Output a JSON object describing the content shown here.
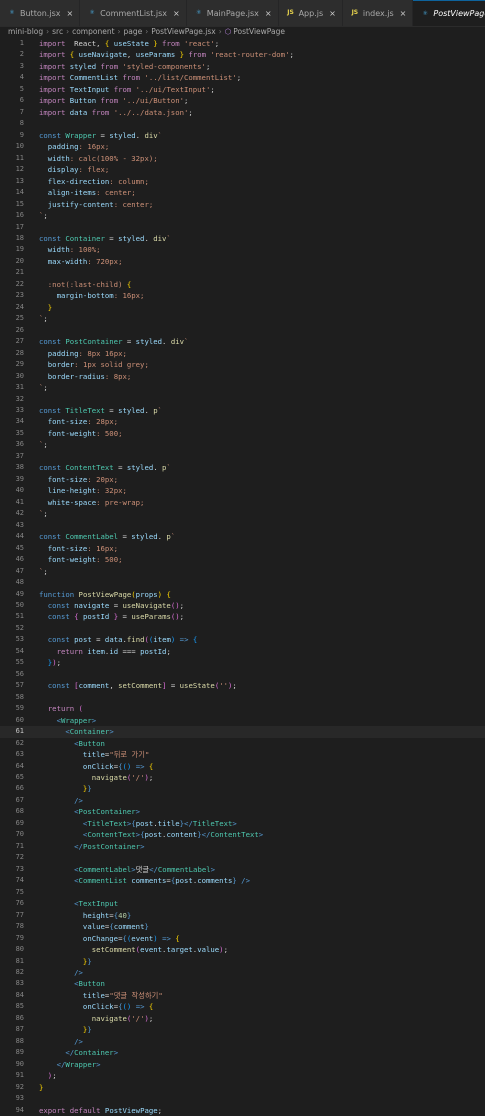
{
  "tabs": [
    {
      "label": "Button.jsx",
      "icon": "react-icon",
      "active": false
    },
    {
      "label": "CommentList.jsx",
      "icon": "react-icon",
      "active": false
    },
    {
      "label": "MainPage.jsx",
      "icon": "react-icon",
      "active": false
    },
    {
      "label": "App.js",
      "icon": "js-icon",
      "active": false
    },
    {
      "label": "index.js",
      "icon": "js-icon",
      "active": false
    },
    {
      "label": "PostViewPage.jsx",
      "icon": "react-icon",
      "active": true
    }
  ],
  "breadcrumb": [
    "mini-blog",
    "src",
    "component",
    "page",
    "PostViewPage.jsx",
    "PostViewPage"
  ],
  "active_line": 61,
  "lines": [
    [
      [
        "kw",
        "import"
      ],
      [
        "",
        "  React, "
      ],
      [
        "br1",
        "{"
      ],
      [
        "var",
        " useState "
      ],
      [
        "br1",
        "}"
      ],
      [
        "kw",
        " from "
      ],
      [
        "str",
        "'react'"
      ],
      [
        "",
        ";"
      ]
    ],
    [
      [
        "kw",
        "import"
      ],
      [
        "",
        " "
      ],
      [
        "br1",
        "{"
      ],
      [
        "var",
        " useNavigate"
      ],
      [
        "",
        ", "
      ],
      [
        "var",
        "useParams "
      ],
      [
        "br1",
        "}"
      ],
      [
        "kw",
        " from "
      ],
      [
        "str",
        "'react-router-dom'"
      ],
      [
        "",
        ";"
      ]
    ],
    [
      [
        "kw",
        "import"
      ],
      [
        "var",
        " styled"
      ],
      [
        "kw",
        " from "
      ],
      [
        "str",
        "'styled-components'"
      ],
      [
        "",
        ";"
      ]
    ],
    [
      [
        "kw",
        "import"
      ],
      [
        "var",
        " CommentList"
      ],
      [
        "kw",
        " from "
      ],
      [
        "str",
        "'../list/CommentList'"
      ],
      [
        "",
        ";"
      ]
    ],
    [
      [
        "kw",
        "import"
      ],
      [
        "var",
        " TextInput"
      ],
      [
        "kw",
        " from "
      ],
      [
        "str",
        "'../ui/TextInput'"
      ],
      [
        "",
        ";"
      ]
    ],
    [
      [
        "kw",
        "import"
      ],
      [
        "var",
        " Button"
      ],
      [
        "kw",
        " from "
      ],
      [
        "str",
        "'../ui/Button'"
      ],
      [
        "",
        ";"
      ]
    ],
    [
      [
        "kw",
        "import"
      ],
      [
        "var",
        " data"
      ],
      [
        "kw",
        " from "
      ],
      [
        "str",
        "'../../data.json'"
      ],
      [
        "",
        ";"
      ]
    ],
    [],
    [
      [
        "st",
        "const "
      ],
      [
        "comp",
        "Wrapper"
      ],
      [
        "",
        " = "
      ],
      [
        "var",
        "styled"
      ],
      [
        "",
        ". "
      ],
      [
        "fn",
        "div"
      ],
      [
        "str",
        "`"
      ]
    ],
    [
      [
        "cssp",
        "  padding"
      ],
      [
        "str",
        ": 16px;"
      ]
    ],
    [
      [
        "cssp",
        "  width"
      ],
      [
        "str",
        ": calc(100% - 32px);"
      ]
    ],
    [
      [
        "cssp",
        "  display"
      ],
      [
        "str",
        ": flex;"
      ]
    ],
    [
      [
        "cssp",
        "  flex-direction"
      ],
      [
        "str",
        ": column;"
      ]
    ],
    [
      [
        "cssp",
        "  align-items"
      ],
      [
        "str",
        ": center;"
      ]
    ],
    [
      [
        "cssp",
        "  justify-content"
      ],
      [
        "str",
        ": center;"
      ]
    ],
    [
      [
        "str",
        "`"
      ],
      [
        "",
        ";"
      ]
    ],
    [],
    [
      [
        "st",
        "const "
      ],
      [
        "comp",
        "Container"
      ],
      [
        "",
        " = "
      ],
      [
        "var",
        "styled"
      ],
      [
        "",
        ". "
      ],
      [
        "fn",
        "div"
      ],
      [
        "str",
        "`"
      ]
    ],
    [
      [
        "cssp",
        "  width"
      ],
      [
        "str",
        ": 100%;"
      ]
    ],
    [
      [
        "cssp",
        "  max-width"
      ],
      [
        "str",
        ": 720px;"
      ]
    ],
    [],
    [
      [
        "str",
        "  :not(:last-child) "
      ],
      [
        "br1",
        "{"
      ]
    ],
    [
      [
        "cssp",
        "    margin-bottom"
      ],
      [
        "str",
        ": 16px;"
      ]
    ],
    [
      [
        "br1",
        "  }"
      ]
    ],
    [
      [
        "str",
        "`"
      ],
      [
        "",
        ";"
      ]
    ],
    [],
    [
      [
        "st",
        "const "
      ],
      [
        "comp",
        "PostContainer"
      ],
      [
        "",
        " = "
      ],
      [
        "var",
        "styled"
      ],
      [
        "",
        ". "
      ],
      [
        "fn",
        "div"
      ],
      [
        "str",
        "`"
      ]
    ],
    [
      [
        "cssp",
        "  padding"
      ],
      [
        "str",
        ": 8px 16px;"
      ]
    ],
    [
      [
        "cssp",
        "  border"
      ],
      [
        "str",
        ": 1px solid grey;"
      ]
    ],
    [
      [
        "cssp",
        "  border-radius"
      ],
      [
        "str",
        ": 8px;"
      ]
    ],
    [
      [
        "str",
        "`"
      ],
      [
        "",
        ";"
      ]
    ],
    [],
    [
      [
        "st",
        "const "
      ],
      [
        "comp",
        "TitleText"
      ],
      [
        "",
        " = "
      ],
      [
        "var",
        "styled"
      ],
      [
        "",
        ". "
      ],
      [
        "fn",
        "p"
      ],
      [
        "str",
        "`"
      ]
    ],
    [
      [
        "cssp",
        "  font-size"
      ],
      [
        "str",
        ": 28px;"
      ]
    ],
    [
      [
        "cssp",
        "  font-weight"
      ],
      [
        "str",
        ": 500;"
      ]
    ],
    [
      [
        "str",
        "`"
      ],
      [
        "",
        ";"
      ]
    ],
    [],
    [
      [
        "st",
        "const "
      ],
      [
        "comp",
        "ContentText"
      ],
      [
        "",
        " = "
      ],
      [
        "var",
        "styled"
      ],
      [
        "",
        ". "
      ],
      [
        "fn",
        "p"
      ],
      [
        "str",
        "`"
      ]
    ],
    [
      [
        "cssp",
        "  font-size"
      ],
      [
        "str",
        ": 20px;"
      ]
    ],
    [
      [
        "cssp",
        "  line-height"
      ],
      [
        "str",
        ": 32px;"
      ]
    ],
    [
      [
        "cssp",
        "  white-space"
      ],
      [
        "str",
        ": pre-wrap;"
      ]
    ],
    [
      [
        "str",
        "`"
      ],
      [
        "",
        ";"
      ]
    ],
    [],
    [
      [
        "st",
        "const "
      ],
      [
        "comp",
        "CommentLabel"
      ],
      [
        "",
        " = "
      ],
      [
        "var",
        "styled"
      ],
      [
        "",
        ". "
      ],
      [
        "fn",
        "p"
      ],
      [
        "str",
        "`"
      ]
    ],
    [
      [
        "cssp",
        "  font-size"
      ],
      [
        "str",
        ": 16px;"
      ]
    ],
    [
      [
        "cssp",
        "  font-weight"
      ],
      [
        "str",
        ": 500;"
      ]
    ],
    [
      [
        "str",
        "`"
      ],
      [
        "",
        ";"
      ]
    ],
    [],
    [
      [
        "st",
        "function "
      ],
      [
        "fn",
        "PostViewPage"
      ],
      [
        "br1",
        "("
      ],
      [
        "var",
        "props"
      ],
      [
        "br1",
        ")"
      ],
      [
        "",
        " "
      ],
      [
        "br1",
        "{"
      ]
    ],
    [
      [
        "st",
        "  const "
      ],
      [
        "var",
        "navigate"
      ],
      [
        "",
        " = "
      ],
      [
        "fn",
        "useNavigate"
      ],
      [
        "br2",
        "()"
      ],
      [
        "",
        ";"
      ]
    ],
    [
      [
        "st",
        "  const "
      ],
      [
        "br2",
        "{"
      ],
      [
        "var",
        " postId "
      ],
      [
        "br2",
        "}"
      ],
      [
        "",
        " = "
      ],
      [
        "fn",
        "useParams"
      ],
      [
        "br2",
        "()"
      ],
      [
        "",
        ";"
      ]
    ],
    [],
    [
      [
        "st",
        "  const "
      ],
      [
        "var",
        "post"
      ],
      [
        "",
        " = "
      ],
      [
        "var",
        "data"
      ],
      [
        "",
        "."
      ],
      [
        "fn",
        "find"
      ],
      [
        "br2",
        "("
      ],
      [
        "br3",
        "("
      ],
      [
        "var",
        "item"
      ],
      [
        "br3",
        ")"
      ],
      [
        "st",
        " =>"
      ],
      [
        "",
        " "
      ],
      [
        "br3",
        "{"
      ]
    ],
    [
      [
        "kw",
        "    return "
      ],
      [
        "var",
        "item"
      ],
      [
        "",
        "."
      ],
      [
        "var",
        "id"
      ],
      [
        "",
        " === "
      ],
      [
        "var",
        "postId"
      ],
      [
        "",
        ";"
      ]
    ],
    [
      [
        "br3",
        "  }"
      ],
      [
        "br2",
        ")"
      ],
      [
        "",
        ";"
      ]
    ],
    [],
    [
      [
        "st",
        "  const "
      ],
      [
        "br2",
        "["
      ],
      [
        "var",
        "comment"
      ],
      [
        "",
        ", "
      ],
      [
        "fn",
        "setComment"
      ],
      [
        "br2",
        "]"
      ],
      [
        "",
        " = "
      ],
      [
        "fn",
        "useState"
      ],
      [
        "br2",
        "("
      ],
      [
        "str",
        "''"
      ],
      [
        "br2",
        ")"
      ],
      [
        "",
        ";"
      ]
    ],
    [],
    [
      [
        "kw",
        "  return "
      ],
      [
        "br2",
        "("
      ]
    ],
    [
      [
        "tag",
        "    <"
      ],
      [
        "comp",
        "Wrapper"
      ],
      [
        "tag",
        ">"
      ]
    ],
    [
      [
        "tag",
        "      <"
      ],
      [
        "comp",
        "Container"
      ],
      [
        "tag",
        ">"
      ]
    ],
    [
      [
        "tag",
        "        <"
      ],
      [
        "comp",
        "Button"
      ]
    ],
    [
      [
        "var",
        "          title"
      ],
      [
        "",
        "="
      ],
      [
        "str",
        "\"뒤로 가기\""
      ]
    ],
    [
      [
        "var",
        "          onClick"
      ],
      [
        "",
        "="
      ],
      [
        "st",
        "{"
      ],
      [
        "br3",
        "()"
      ],
      [
        "st",
        " =>"
      ],
      [
        "",
        " "
      ],
      [
        "br1",
        "{"
      ]
    ],
    [
      [
        "fn",
        "            navigate"
      ],
      [
        "br2",
        "("
      ],
      [
        "str",
        "'/'"
      ],
      [
        "br2",
        ")"
      ],
      [
        "",
        ";"
      ]
    ],
    [
      [
        "br1",
        "          }"
      ],
      [
        "st",
        "}"
      ]
    ],
    [
      [
        "tag",
        "        />"
      ]
    ],
    [
      [
        "tag",
        "        <"
      ],
      [
        "comp",
        "PostContainer"
      ],
      [
        "tag",
        ">"
      ]
    ],
    [
      [
        "tag",
        "          <"
      ],
      [
        "comp",
        "TitleText"
      ],
      [
        "tag",
        ">"
      ],
      [
        "st",
        "{"
      ],
      [
        "var",
        "post"
      ],
      [
        "",
        "."
      ],
      [
        "var",
        "title"
      ],
      [
        "st",
        "}"
      ],
      [
        "tag",
        "</"
      ],
      [
        "comp",
        "TitleText"
      ],
      [
        "tag",
        ">"
      ]
    ],
    [
      [
        "tag",
        "          <"
      ],
      [
        "comp",
        "ContentText"
      ],
      [
        "tag",
        ">"
      ],
      [
        "st",
        "{"
      ],
      [
        "var",
        "post"
      ],
      [
        "",
        "."
      ],
      [
        "var",
        "content"
      ],
      [
        "st",
        "}"
      ],
      [
        "tag",
        "</"
      ],
      [
        "comp",
        "ContentText"
      ],
      [
        "tag",
        ">"
      ]
    ],
    [
      [
        "tag",
        "        </"
      ],
      [
        "comp",
        "PostContainer"
      ],
      [
        "tag",
        ">"
      ]
    ],
    [],
    [
      [
        "tag",
        "        <"
      ],
      [
        "comp",
        "CommentLabel"
      ],
      [
        "tag",
        ">"
      ],
      [
        "",
        "댓글"
      ],
      [
        "tag",
        "</"
      ],
      [
        "comp",
        "CommentLabel"
      ],
      [
        "tag",
        ">"
      ]
    ],
    [
      [
        "tag",
        "        <"
      ],
      [
        "comp",
        "CommentList"
      ],
      [
        "var",
        " comments"
      ],
      [
        "",
        "="
      ],
      [
        "st",
        "{"
      ],
      [
        "var",
        "post"
      ],
      [
        "",
        "."
      ],
      [
        "var",
        "comments"
      ],
      [
        "st",
        "}"
      ],
      [
        "tag",
        " />"
      ]
    ],
    [],
    [
      [
        "tag",
        "        <"
      ],
      [
        "comp",
        "TextInput"
      ]
    ],
    [
      [
        "var",
        "          height"
      ],
      [
        "",
        "="
      ],
      [
        "st",
        "{"
      ],
      [
        "num",
        "40"
      ],
      [
        "st",
        "}"
      ]
    ],
    [
      [
        "var",
        "          value"
      ],
      [
        "",
        "="
      ],
      [
        "st",
        "{"
      ],
      [
        "var",
        "comment"
      ],
      [
        "st",
        "}"
      ]
    ],
    [
      [
        "var",
        "          onChange"
      ],
      [
        "",
        "="
      ],
      [
        "st",
        "{"
      ],
      [
        "br3",
        "("
      ],
      [
        "var",
        "event"
      ],
      [
        "br3",
        ")"
      ],
      [
        "st",
        " =>"
      ],
      [
        "",
        " "
      ],
      [
        "br1",
        "{"
      ]
    ],
    [
      [
        "fn",
        "            setComment"
      ],
      [
        "br2",
        "("
      ],
      [
        "var",
        "event"
      ],
      [
        "",
        "."
      ],
      [
        "var",
        "target"
      ],
      [
        "",
        "."
      ],
      [
        "var",
        "value"
      ],
      [
        "br2",
        ")"
      ],
      [
        "",
        ";"
      ]
    ],
    [
      [
        "br1",
        "          }"
      ],
      [
        "st",
        "}"
      ]
    ],
    [
      [
        "tag",
        "        />"
      ]
    ],
    [
      [
        "tag",
        "        <"
      ],
      [
        "comp",
        "Button"
      ]
    ],
    [
      [
        "var",
        "          title"
      ],
      [
        "",
        "="
      ],
      [
        "str",
        "\"댓글 작성하기\""
      ]
    ],
    [
      [
        "var",
        "          onClick"
      ],
      [
        "",
        "="
      ],
      [
        "st",
        "{"
      ],
      [
        "br3",
        "()"
      ],
      [
        "st",
        " =>"
      ],
      [
        "",
        " "
      ],
      [
        "br1",
        "{"
      ]
    ],
    [
      [
        "fn",
        "            navigate"
      ],
      [
        "br2",
        "("
      ],
      [
        "str",
        "'/'"
      ],
      [
        "br2",
        ")"
      ],
      [
        "",
        ";"
      ]
    ],
    [
      [
        "br1",
        "          }"
      ],
      [
        "st",
        "}"
      ]
    ],
    [
      [
        "tag",
        "        />"
      ]
    ],
    [
      [
        "tag",
        "      </"
      ],
      [
        "comp",
        "Container"
      ],
      [
        "tag",
        ">"
      ]
    ],
    [
      [
        "tag",
        "    </"
      ],
      [
        "comp",
        "Wrapper"
      ],
      [
        "tag",
        ">"
      ]
    ],
    [
      [
        "br2",
        "  )"
      ],
      [
        "",
        ";"
      ]
    ],
    [
      [
        "br1",
        "}"
      ]
    ],
    [],
    [
      [
        "kw",
        "export "
      ],
      [
        "kw",
        "default "
      ],
      [
        "var",
        "PostViewPage"
      ],
      [
        "",
        ";"
      ]
    ]
  ]
}
